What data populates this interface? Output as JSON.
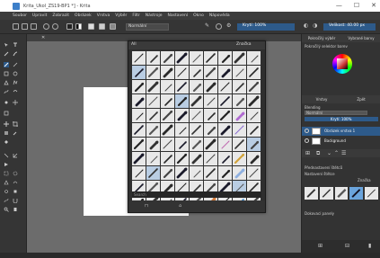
{
  "window": {
    "title": "Krita_Ukol_ZS19-BP1 *] - Krita",
    "minimize": "—",
    "maximize": "☐",
    "close": "✕"
  },
  "menu": [
    "Soubor",
    "Upravit",
    "Zobrazit",
    "Obrázek",
    "Vrstva",
    "Výběr",
    "Filtr",
    "Nástroje",
    "Nastavení",
    "Okno",
    "Nápověda"
  ],
  "toolbar": {
    "blend_mode": "Normální",
    "opacity": "Krytí: 100%",
    "size": "Velikost: 40.00 px"
  },
  "brush_popup": {
    "tag": "All",
    "filter_label": "Značka",
    "search_placeholder": "Search"
  },
  "right_dock": {
    "tabs": [
      "Pokročilý výběr",
      "Vybrané barvy"
    ],
    "section_colors": "Pokročilý selektor barev",
    "layers_tabs": [
      "Vrstvy",
      "Zpět"
    ],
    "blending_label": "Blending",
    "blending_value": "Normální",
    "opacity_value": "Krytí: 100%",
    "layers": [
      {
        "name": "Obrázek vrstva 1",
        "selected": true
      },
      {
        "name": "Background",
        "selected": false
      }
    ],
    "presets_label": "Přednastavení štětců",
    "presets_tag": "Značka",
    "presets_section": "Nastavení štětce",
    "history_label": "Dokovací panely"
  }
}
